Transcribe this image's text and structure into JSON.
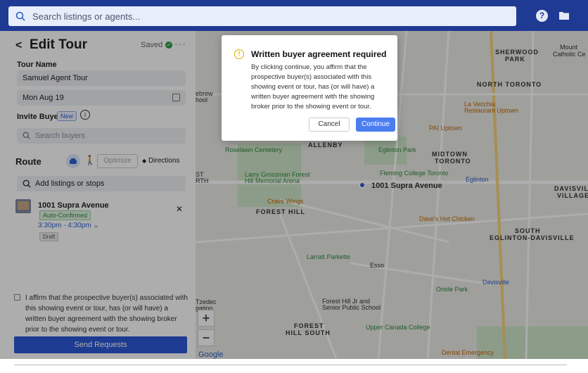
{
  "search": {
    "placeholder": "Search listings or agents..."
  },
  "header": {
    "help_label": "?"
  },
  "tour": {
    "back_label": "<",
    "title": "Edit Tour",
    "saved_label": "Saved",
    "more_label": "···",
    "name_label": "Tour Name",
    "name_value": "Samuel Agent Tour",
    "date_value": "Mon Aug 19",
    "invite_label": "Invite Buyers",
    "new_badge": "New",
    "search_buyers_placeholder": "Search buyers"
  },
  "route": {
    "label": "Route",
    "optimize_label": "Optimize",
    "directions_label": "Directions",
    "add_placeholder": "Add listings or stops"
  },
  "listing": {
    "name": "1001 Supra Avenue",
    "status": "Auto-Confirmed",
    "time": "3:30pm - 4:30pm",
    "draft": "Draft"
  },
  "footer": {
    "affirm_text": "I affirm that the prospective buyer(s) associated with this showing event or tour, has (or will have) a written buyer agreement with the showing broker prior to the showing event or tour.",
    "send_label": "Send Requests"
  },
  "modal": {
    "title": "Written buyer agreement required",
    "body": "By clicking continue, you affirm that the prospective buyer(s) associated with this showing event or tour, has (or will have) a written buyer agreement with the showing broker prior to the showing event or tour.",
    "cancel_label": "Cancel",
    "continue_label": "Continue"
  },
  "map": {
    "labels": {
      "sherwood": "SHERWOOD",
      "park": "PARK",
      "north_toronto": "NORTH TORONTO",
      "la_vecchia": "La Vecchia",
      "restaurant_uptown": "Restaurant Uptown",
      "pai": "PAI Uptown",
      "allenby": "ALLENBY",
      "roselawn": "Roselawn Cemetery",
      "eglinton_park": "Eglinton Park",
      "midtown": "MIDTOWN",
      "toronto": "TORONTO",
      "fleming": "Fleming College Toronto",
      "eglinton": "Eglinton",
      "grossman": "Larry Grossman Forest",
      "hill_memorial": "Hill Memorial Arena",
      "supra": "1001 Supra Avenue",
      "davisville": "DAVISVILLE",
      "village": "VILLAGE",
      "crave": "Crave Wings",
      "forest_hill": "FOREST HILL",
      "daves": "Dave's Hot Chicken",
      "south": "SOUTH",
      "eglinton_davisville": "EGLINTON-DAVISVILLE",
      "larratt": "Larratt Parkette",
      "esso": "Esso",
      "oriole": "Oriole Park",
      "davisville_stn": "Davisville",
      "forest_hill_jr": "Forest Hill Jr and",
      "senior_school": "Senior Public School",
      "forest_hill_south_1": "FOREST",
      "forest_hill_south_2": "HILL SOUTH",
      "ucc": "Upper Canada College",
      "dental": "Dental Emergency",
      "google": "Google",
      "tzedec": "Tzedec",
      "gation": "gation",
      "ebrew": "ebrew",
      "hool": "hool",
      "st": "ST",
      "rth": "RTH",
      "mount": "Mount",
      "catholic": "Catholic Ce"
    },
    "zoom_in": "+",
    "zoom_out": "−"
  },
  "colors": {
    "topbar": "#1f3a93",
    "primary_button": "#2d57d8",
    "continue_button": "#4a7df0",
    "warning": "#e0a800",
    "confirmed": "#2e8a3e"
  },
  "icons": {
    "search": "search-icon",
    "help": "help-icon",
    "folder": "folder-icon",
    "warning": "warning-icon",
    "calendar": "calendar-icon",
    "car": "car-icon",
    "walk": "walk-icon"
  }
}
